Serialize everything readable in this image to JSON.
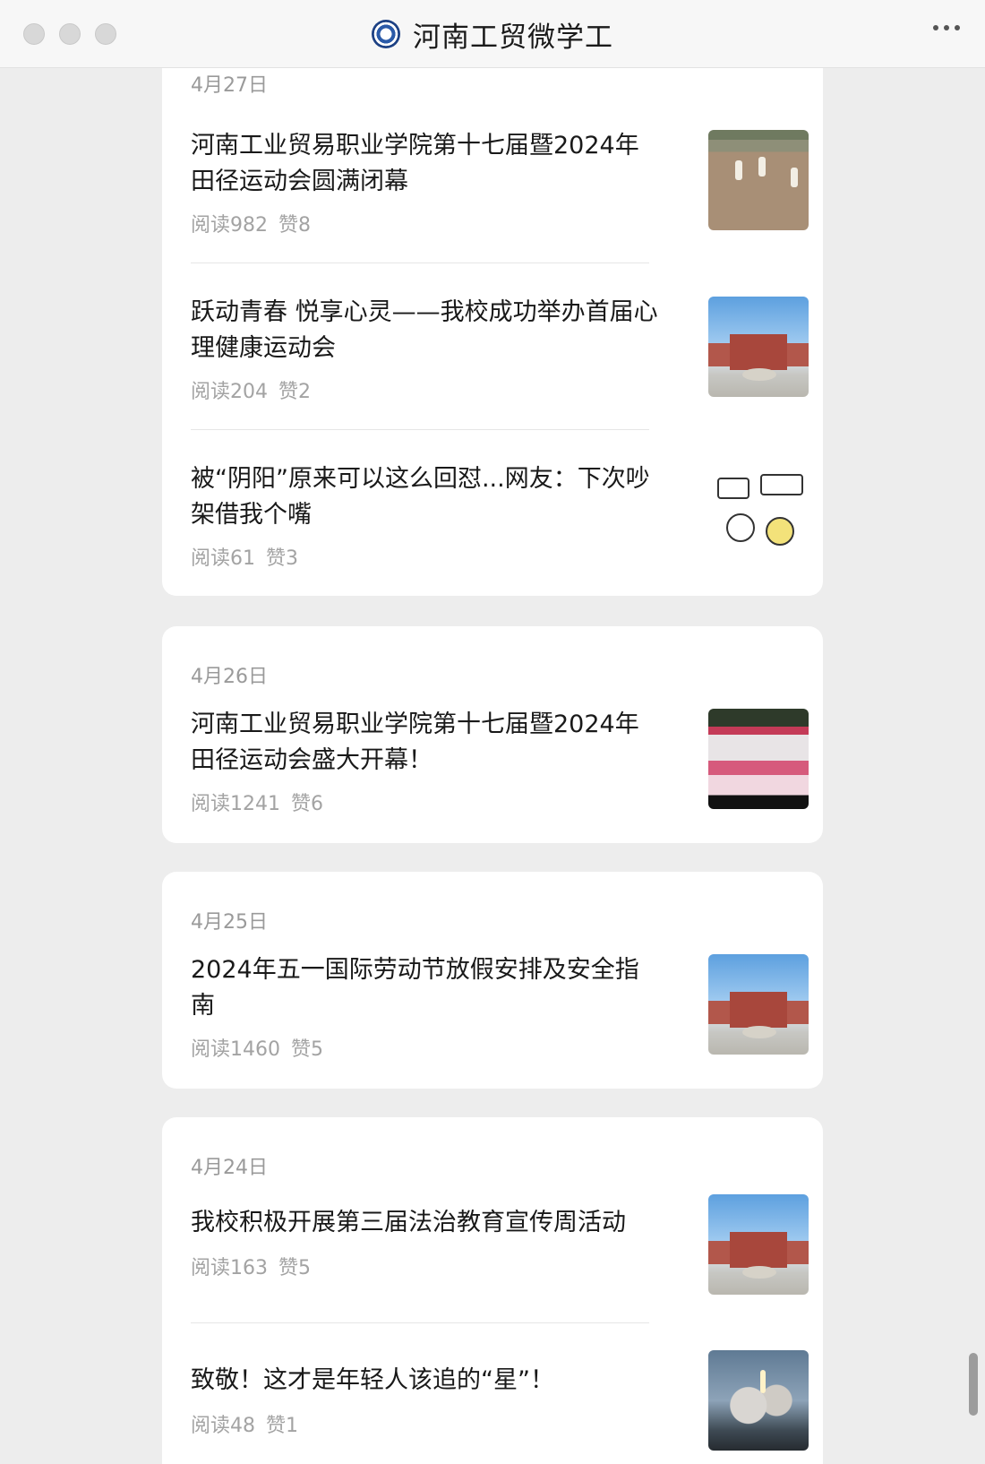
{
  "window": {
    "title": "河南工贸微学工"
  },
  "groups": [
    {
      "date": "4月27日",
      "articles": [
        {
          "title": "河南工业贸易职业学院第十七届暨2024年田径运动会圆满闭幕",
          "reads": "阅读982",
          "likes": "赞8"
        },
        {
          "title": "跃动青春 悦享心灵——我校成功举办首届心理健康运动会",
          "reads": "阅读204",
          "likes": "赞2"
        },
        {
          "title": "被“阴阳”原来可以这么回怼...网友：下次吵架借我个嘴",
          "reads": "阅读61",
          "likes": "赞3"
        }
      ]
    },
    {
      "date": "4月26日",
      "articles": [
        {
          "title": "河南工业贸易职业学院第十七届暨2024年田径运动会盛大开幕！",
          "reads": "阅读1241",
          "likes": "赞6"
        }
      ]
    },
    {
      "date": "4月25日",
      "articles": [
        {
          "title": "2024年五一国际劳动节放假安排及安全指南",
          "reads": "阅读1460",
          "likes": "赞5"
        }
      ]
    },
    {
      "date": "4月24日",
      "articles": [
        {
          "title": "我校积极开展第三届法治教育宣传周活动",
          "reads": "阅读163",
          "likes": "赞5"
        },
        {
          "title": "致敬！这才是年轻人该追的“星”！",
          "reads": "阅读48",
          "likes": "赞1"
        }
      ]
    }
  ]
}
